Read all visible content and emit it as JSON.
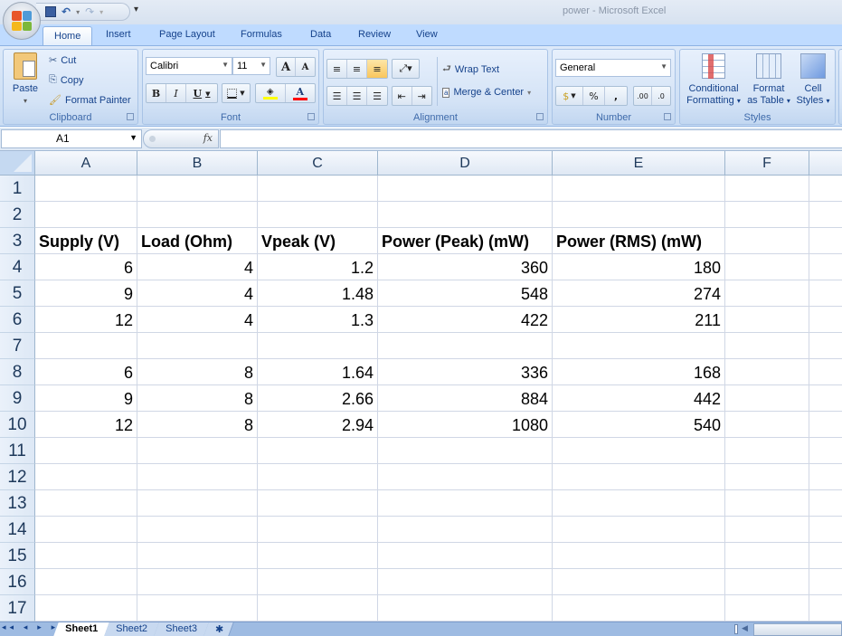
{
  "window": {
    "title": "power - Microsoft Excel"
  },
  "quick_access": {
    "icons": [
      "save-icon",
      "undo-icon",
      "redo-icon",
      "customize-icon"
    ],
    "undo": "↶",
    "redo": "↷",
    "more": "▾"
  },
  "tabs": [
    {
      "label": "Home",
      "active": true
    },
    {
      "label": "Insert"
    },
    {
      "label": "Page Layout"
    },
    {
      "label": "Formulas"
    },
    {
      "label": "Data"
    },
    {
      "label": "Review"
    },
    {
      "label": "View"
    }
  ],
  "ribbon": {
    "clipboard": {
      "label": "Clipboard",
      "paste": "Paste",
      "cut": "Cut",
      "copy": "Copy",
      "format_painter": "Format Painter"
    },
    "font": {
      "label": "Font",
      "font_name": "Calibri",
      "font_size": "11",
      "grow": "A",
      "shrink": "A",
      "bold": "B",
      "italic": "I",
      "underline": "U",
      "fill_color": "#ffff00",
      "font_color": "#ff0000"
    },
    "alignment": {
      "label": "Alignment",
      "wrap_text": "Wrap Text",
      "merge_center": "Merge & Center"
    },
    "number": {
      "label": "Number",
      "format": "General",
      "percent": "%",
      "comma": ",",
      "inc_decimal": ".00",
      "dec_decimal": ".0"
    },
    "styles": {
      "label": "Styles",
      "conditional_1": "Conditional",
      "conditional_2": "Formatting",
      "format_table_1": "Format",
      "format_table_2": "as Table",
      "cell_styles_1": "Cell",
      "cell_styles_2": "Styles"
    }
  },
  "formula_bar": {
    "name_box": "A1",
    "fx": "fx",
    "formula": ""
  },
  "columns": [
    "A",
    "B",
    "C",
    "D",
    "E",
    "F"
  ],
  "rows": [
    "1",
    "2",
    "3",
    "4",
    "5",
    "6",
    "7",
    "8",
    "9",
    "10",
    "11",
    "12",
    "13",
    "14",
    "15",
    "16",
    "17"
  ],
  "cells": {
    "3": [
      "Supply (V)",
      "Load (Ohm)",
      "Vpeak (V)",
      "Power (Peak) (mW)",
      "Power (RMS) (mW)",
      ""
    ],
    "4": [
      "6",
      "4",
      "1.2",
      "360",
      "180",
      ""
    ],
    "5": [
      "9",
      "4",
      "1.48",
      "548",
      "274",
      ""
    ],
    "6": [
      "12",
      "4",
      "1.3",
      "422",
      "211",
      ""
    ],
    "8": [
      "6",
      "8",
      "1.64",
      "336",
      "168",
      ""
    ],
    "9": [
      "9",
      "8",
      "2.66",
      "884",
      "442",
      ""
    ],
    "10": [
      "12",
      "8",
      "2.94",
      "1080",
      "540",
      ""
    ]
  },
  "sheets": [
    {
      "label": "Sheet1",
      "active": true
    },
    {
      "label": "Sheet2"
    },
    {
      "label": "Sheet3"
    }
  ],
  "sheet_nav": "◂◂ ◂ ▸ ▸▸"
}
